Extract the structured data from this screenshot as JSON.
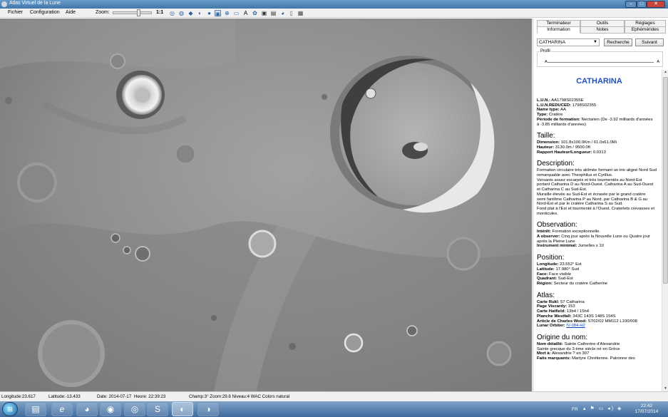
{
  "window": {
    "title": "Atlas Virtuel de la Lune",
    "minimize_glyph": "–",
    "maximize_glyph": "□",
    "close_glyph": "✕"
  },
  "menu": {
    "items": [
      "Fichier",
      "Configuration",
      "Aide"
    ]
  },
  "toolbar": {
    "zoom_label": "Zoom:",
    "zoom_reset": "1:1",
    "zoom_level": 0.68,
    "tools": [
      {
        "name": "grid-globe-icon",
        "glyph": "◎"
      },
      {
        "name": "rotate-globe-icon",
        "glyph": "◍"
      },
      {
        "name": "flip-icon",
        "glyph": "◆"
      },
      {
        "name": "moon-phase-icon",
        "glyph": "◐"
      },
      {
        "name": "lighting-icon",
        "glyph": "●"
      },
      {
        "name": "libration-icon",
        "glyph": "◉"
      },
      {
        "name": "crosshair-icon",
        "glyph": "⊕"
      },
      {
        "name": "ruler-icon",
        "glyph": "▭"
      },
      {
        "name": "label-font-icon",
        "glyph": "A"
      },
      {
        "name": "settings-gear-icon",
        "glyph": "✿"
      },
      {
        "name": "camera-icon",
        "glyph": "▣"
      },
      {
        "name": "print-icon",
        "glyph": "▤"
      },
      {
        "name": "web-globe-icon",
        "glyph": "◕"
      },
      {
        "name": "document-icon",
        "glyph": "▯"
      },
      {
        "name": "image-icon",
        "glyph": "▦"
      }
    ]
  },
  "panel": {
    "tabs_top": [
      "Terminateur",
      "Outils",
      "Réglages"
    ],
    "tabs_bottom": [
      "Information",
      "Notes",
      "Ephémérides"
    ],
    "active_tab": "Information",
    "search": {
      "value": "CATHARINA",
      "button_search": "Recherche",
      "button_next": "Suivant"
    },
    "profile": {
      "label": "Profil",
      "start": "A",
      "end": "A"
    }
  },
  "info": {
    "title": "CATHARINA",
    "header_fields": [
      {
        "label": "L.U.N.:",
        "value": " AA1798S02355E"
      },
      {
        "label": "L.U.N.REDUCED:",
        "value": " 1798S02355"
      },
      {
        "label": "Name type:",
        "value": " AA"
      },
      {
        "label": "Type:",
        "value": " Cratère"
      },
      {
        "label": "Période de formation:",
        "value": " Nectarien (De -3.92 milliards d'années"
      }
    ],
    "header_continuation": "à -3.85 milliards d'années)",
    "taille_heading": "Taille:",
    "taille_fields": [
      {
        "label": "Dimension:",
        "value": " 101.8x100.0Km / 61.0x61.0Mi"
      },
      {
        "label": "Hauteur:",
        "value": " 3130.0m / 9500.0ft"
      },
      {
        "label": "Rapport Hauteur/Longueur:",
        "value": " 0.0313"
      }
    ],
    "description_heading": "Description:",
    "description_lines": [
      "Formation circulaire très abîmée formant un trio aligné Nord Sud",
      "remarquable avec Theophilus et Cyrillus.",
      "Versants assez escarpés et très tourmentés au Nord-Est",
      "portant Catharina D au Nord-Ouest. Catharina A au Sud-Ouest",
      "et Catharina C au Sud-Est.",
      "Muraille élevée au Sud-Est et écrasée par le grand cratère",
      "semi fantôme Catharina P au Nord. par Catharina B & G au",
      "Nord-Est et par le cratère Catharina S au Sud.",
      "Fond plat à l'Est et tourmenté à l'Ouest. Craterlets crevasses et",
      "monticules."
    ],
    "observation_heading": "Observation:",
    "observation_interest": {
      "label": "Intérêt:",
      "value": " Formation exceptionnelle."
    },
    "observation_when": {
      "label": "A observer:",
      "value": " Cinq jour après la Nouvelle Lune ou Quatre jour"
    },
    "observation_when_continuation": "après la Pleine Lune",
    "observation_instrument": {
      "label": "Instrument minimal:",
      "value": " Jumelles x 10"
    },
    "position_heading": "Position:",
    "position_fields": [
      {
        "label": "Longitude:",
        "value": " 23.552° Est"
      },
      {
        "label": "Latitude:",
        "value": " 17.980° Sud"
      },
      {
        "label": "Face:",
        "value": " Face visible"
      },
      {
        "label": "Quadrant:",
        "value": " Sud-Est"
      },
      {
        "label": "Région:",
        "value": " Secteur du cratère Catherine"
      }
    ],
    "atlas_heading": "Atlas:",
    "atlas_fields": [
      {
        "label": "Carte Rukl:",
        "value": " 57 Catharina"
      },
      {
        "label": "Page Viscardy:",
        "value": " 153"
      },
      {
        "label": "Carte Hatfield:",
        "value": " 13b4 / 15h4"
      },
      {
        "label": "Planche Westfall:",
        "value": " 343C 143S 148S 154S"
      },
      {
        "label": "Article de Charles Wood:",
        "value": " ST02/02 MM112 L100/008"
      }
    ],
    "lunar_orbiter": {
      "label": "Lunar Orbiter:",
      "link": "IV-084-H2"
    },
    "origine_heading": "Origine du nom:",
    "origine_detail": {
      "label": "Nom détaillé:",
      "value": " Sainte Catherine d'Alexandrie"
    },
    "origine_line": "Sainte grecque du 3 ème siècle né en Grèce",
    "origine_death": {
      "label": "Mort à:",
      "value": " Alexandrie ? en 307"
    },
    "origine_facts": {
      "label": "Faits marquants:",
      "value": " Martyre Chrétienne. Patronne des"
    }
  },
  "statusbar": {
    "longitude": "Longitude:23.617",
    "latitude": "Latitude:-13.433",
    "date": "Date: 2014-07-17",
    "time": "Heure: 22:39:23",
    "field": "Champ:3° Zoom:29.8  Niveau:4 WAC Colors natural"
  },
  "taskbar": {
    "apps": [
      {
        "name": "file-explorer-icon",
        "glyph": "▤"
      },
      {
        "name": "internet-explorer-icon",
        "glyph": "e"
      },
      {
        "name": "chrome-icon",
        "glyph": "◕"
      },
      {
        "name": "firefox-icon",
        "glyph": "◉"
      },
      {
        "name": "thunderbird-icon",
        "glyph": "◎"
      },
      {
        "name": "skype-icon",
        "glyph": "S"
      },
      {
        "name": "moon-atlas-app-icon",
        "glyph": "◐"
      },
      {
        "name": "moon-atlas-photo-icon",
        "glyph": "◑"
      }
    ],
    "language": "FR",
    "tray_glyphs": "▴ ⚑ ▭ ◂) ◈",
    "time": "22:42",
    "date": "17/07/2014"
  },
  "colors": {
    "title_blue": "#1f4fbd",
    "window_titlebar": "#3f77aa",
    "taskbar": "#3e6a9d",
    "moon_grey": "#8f8f8f"
  }
}
